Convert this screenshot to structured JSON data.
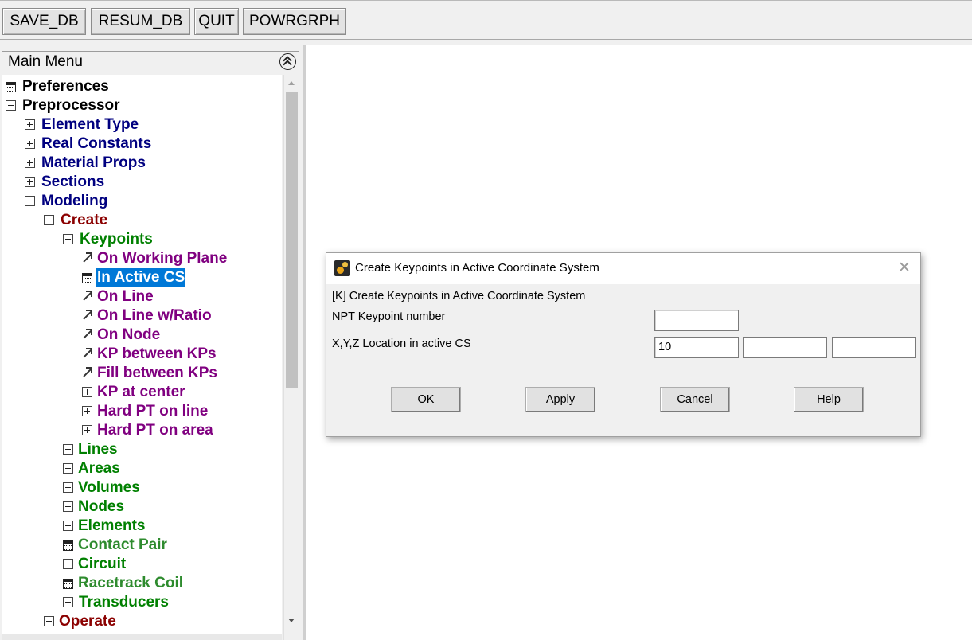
{
  "toolbar": {
    "buttons": [
      "SAVE_DB",
      "RESUM_DB",
      "QUIT",
      "POWRGRPH"
    ]
  },
  "menu": {
    "title": "Main Menu",
    "items": [
      {
        "label": "Preferences",
        "icon": "dialog-icon",
        "color": "#000000"
      },
      {
        "label": "Preprocessor",
        "icon": "collapse-icon",
        "color": "#000000"
      },
      {
        "label": "Element Type",
        "icon": "expand-icon",
        "color": "#000080"
      },
      {
        "label": "Real Constants",
        "icon": "expand-icon",
        "color": "#000080"
      },
      {
        "label": "Material Props",
        "icon": "expand-icon",
        "color": "#000080"
      },
      {
        "label": "Sections",
        "icon": "expand-icon",
        "color": "#000080"
      },
      {
        "label": "Modeling",
        "icon": "collapse-icon",
        "color": "#000080"
      },
      {
        "label": "Create",
        "icon": "collapse-icon",
        "color": "#8b0000"
      },
      {
        "label": "Keypoints",
        "icon": "collapse-icon",
        "color": "#008000"
      },
      {
        "label": "On Working Plane",
        "icon": "pick-arrow-icon",
        "color": "#800080"
      },
      {
        "label": "In Active CS",
        "icon": "dialog-icon",
        "color": "#ffffff",
        "selected": true
      },
      {
        "label": "On Line",
        "icon": "pick-arrow-icon",
        "color": "#800080"
      },
      {
        "label": "On Line w/Ratio",
        "icon": "pick-arrow-icon",
        "color": "#800080"
      },
      {
        "label": "On Node",
        "icon": "pick-arrow-icon",
        "color": "#800080"
      },
      {
        "label": "KP between KPs",
        "icon": "pick-arrow-icon",
        "color": "#800080"
      },
      {
        "label": "Fill between KPs",
        "icon": "pick-arrow-icon",
        "color": "#800080"
      },
      {
        "label": "KP at center",
        "icon": "expand-icon",
        "color": "#800080"
      },
      {
        "label": "Hard PT on line",
        "icon": "expand-icon",
        "color": "#800080"
      },
      {
        "label": "Hard PT on area",
        "icon": "expand-icon",
        "color": "#800080"
      },
      {
        "label": "Lines",
        "icon": "expand-icon",
        "color": "#008000"
      },
      {
        "label": "Areas",
        "icon": "expand-icon",
        "color": "#008000"
      },
      {
        "label": "Volumes",
        "icon": "expand-icon",
        "color": "#008000"
      },
      {
        "label": "Nodes",
        "icon": "expand-icon",
        "color": "#008000"
      },
      {
        "label": "Elements",
        "icon": "expand-icon",
        "color": "#008000"
      },
      {
        "label": "Contact Pair",
        "icon": "dialog-icon",
        "color": "#2e8b2e"
      },
      {
        "label": "Circuit",
        "icon": "expand-icon",
        "color": "#008000"
      },
      {
        "label": "Racetrack Coil",
        "icon": "dialog-icon",
        "color": "#2e8b2e"
      },
      {
        "label": "Transducers",
        "icon": "expand-icon",
        "color": "#008000"
      },
      {
        "label": "Operate",
        "icon": "expand-icon",
        "color": "#8b0000"
      }
    ]
  },
  "dialog": {
    "title": "Create Keypoints in Active Coordinate System",
    "heading": "[K]  Create Keypoints in Active Coordinate System",
    "npt_label": "NPT    Keypoint number",
    "npt_value": "",
    "xyz_label": "X,Y,Z  Location in active CS",
    "x_value": "10",
    "y_value": "",
    "z_value": "",
    "buttons": {
      "ok": "OK",
      "apply": "Apply",
      "cancel": "Cancel",
      "help": "Help"
    }
  }
}
